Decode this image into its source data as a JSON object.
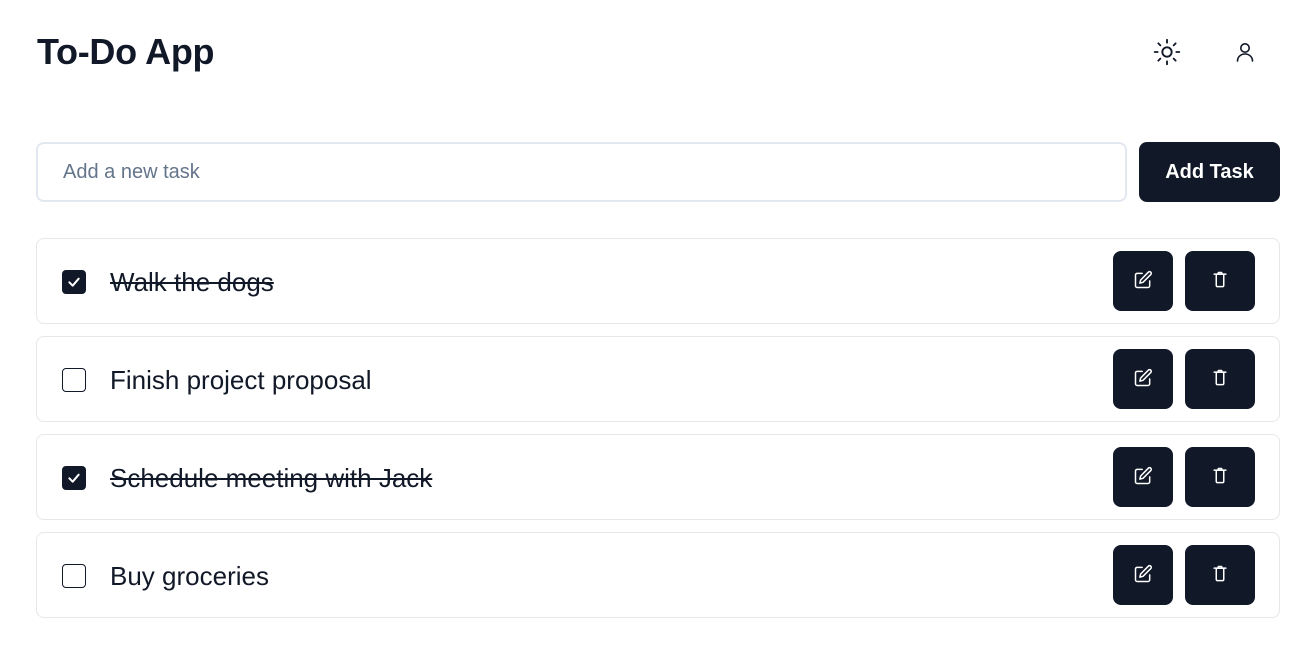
{
  "header": {
    "title": "To-Do App",
    "theme_icon": "sun-icon",
    "user_icon": "user-icon"
  },
  "new_task": {
    "placeholder": "Add a new task",
    "value": "",
    "button_label": "Add Task"
  },
  "colors": {
    "primary": "#111827",
    "border": "#e5e7eb",
    "input_border": "#e2e8f0",
    "placeholder": "#64748b"
  },
  "tasks": [
    {
      "text": "Walk the dogs",
      "completed": true,
      "edit_icon": "edit-icon",
      "delete_icon": "trash-icon"
    },
    {
      "text": "Finish project proposal",
      "completed": false,
      "edit_icon": "edit-icon",
      "delete_icon": "trash-icon"
    },
    {
      "text": "Schedule meeting with Jack",
      "completed": true,
      "edit_icon": "edit-icon",
      "delete_icon": "trash-icon"
    },
    {
      "text": "Buy groceries",
      "completed": false,
      "edit_icon": "edit-icon",
      "delete_icon": "trash-icon"
    }
  ]
}
